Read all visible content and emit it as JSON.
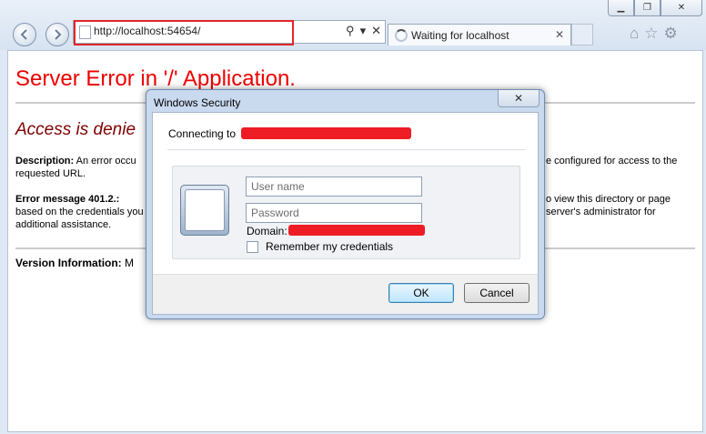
{
  "browser": {
    "address_url": "http://localhost:54654/",
    "tab_title": "Waiting for localhost",
    "tab_close": "✕",
    "highlight_color": "#e2262a"
  },
  "page": {
    "error_title": "Server Error in '/' Application.",
    "access_heading": "Access is denie",
    "description_label": "Description:",
    "description_text_left": "An error occu",
    "description_text_right": "e configured for access to the",
    "description_text_line2": "requested URL.",
    "error_label": "Error message 401.2.:",
    "error_text_right": "o view this directory or page",
    "error_line2_left": "based on the credentials you",
    "error_line2_right": "server's administrator for",
    "error_line3": "additional assistance.",
    "version_label": "Version Information:",
    "version_text": "M"
  },
  "dialog": {
    "title": "Windows Security",
    "close_label": "✕",
    "connecting_label": "Connecting to",
    "username_placeholder": "User name",
    "password_placeholder": "Password",
    "domain_label": "Domain:",
    "remember_label": "Remember my credentials",
    "ok_label": "OK",
    "cancel_label": "Cancel",
    "redaction_color": "#ee1c25"
  }
}
